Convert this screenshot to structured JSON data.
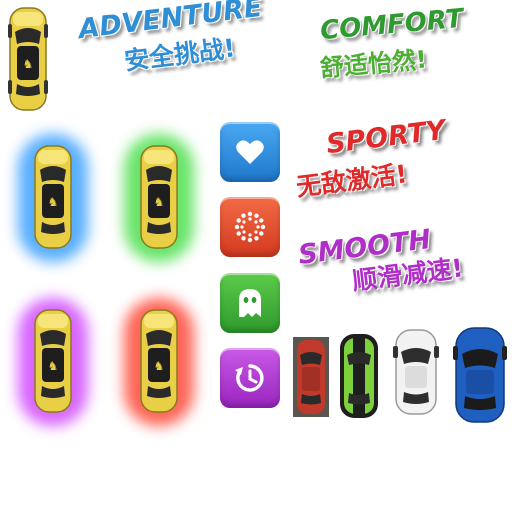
{
  "banners": {
    "adventure": {
      "en": "ADVENTURE",
      "zh": "安全挑战!",
      "color": "#2e8ed6"
    },
    "comfort": {
      "en": "COMFORT",
      "zh": "舒适怡然!",
      "color": "#2f9a2f"
    },
    "sporty": {
      "en": "SPORTY",
      "zh": "无敌激活!",
      "color": "#e02a2a"
    },
    "smooth": {
      "en": "SMOOTH",
      "zh": "顺滑减速!",
      "color": "#b02ec8"
    }
  },
  "buttons": [
    {
      "name": "heart-icon",
      "color": "#2f8fe0"
    },
    {
      "name": "sunburst-icon",
      "color": "#e84d2c"
    },
    {
      "name": "ghost-icon",
      "color": "#3caf3c"
    },
    {
      "name": "history-icon",
      "color": "#b63ad6"
    }
  ],
  "glow_colors": {
    "blue": "#3aa0ff",
    "green": "#4ee04e",
    "purple": "#d24bff",
    "red": "#ff4a3a"
  },
  "car_colors": {
    "yellow": "#f0d850",
    "red": "#c0392b",
    "green_stripe": "#7fd13b",
    "white": "#f2f2f2",
    "blue": "#1f5fbf"
  }
}
